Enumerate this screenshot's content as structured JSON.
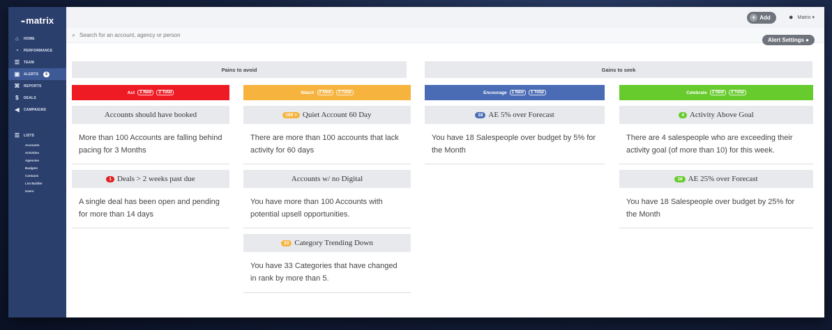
{
  "brand": {
    "name": "matrix"
  },
  "sidebar": {
    "items": [
      {
        "label": "HOME",
        "icon": "home-icon",
        "glyph": "⌂"
      },
      {
        "label": "PERFORMANCE",
        "icon": "chart-icon",
        "glyph": "◔"
      },
      {
        "label": "TEAM",
        "icon": "team-icon",
        "glyph": "☰"
      },
      {
        "label": "ALERTS",
        "icon": "alert-icon",
        "glyph": "▣",
        "badge": "6",
        "active": true
      },
      {
        "label": "REPORTS",
        "icon": "report-icon",
        "glyph": "⌘"
      },
      {
        "label": "DEALS",
        "icon": "dollar-icon",
        "glyph": "$"
      },
      {
        "label": "CAMPAIGNS",
        "icon": "megaphone-icon",
        "glyph": "◀"
      }
    ],
    "lists": {
      "label": "LISTS",
      "icon": "list-icon",
      "glyph": "☰",
      "items": [
        "Accounts",
        "Activities",
        "Agencies",
        "Budgets",
        "Contacts",
        "List Builder",
        "Users"
      ]
    }
  },
  "topbar": {
    "add_label": "Add",
    "user_label": "Matrix ▾"
  },
  "search": {
    "placeholder": "Search for an account, agency or person"
  },
  "alert_settings": {
    "label": "Alert Settings ●"
  },
  "sections": {
    "pains": "Pains to avoid",
    "gains": "Gains to seek"
  },
  "colors": {
    "act": "#ee1b24",
    "watch": "#f6b33e",
    "encourage": "#4a6cb5",
    "celebrate": "#67cb2e"
  },
  "columns": [
    {
      "name": "Act",
      "new": "1 New",
      "total": "2 Total",
      "cards": [
        {
          "title": "Accounts should have booked",
          "count": "",
          "body": "More than 100 Accounts are falling behind pacing for 3 Months"
        },
        {
          "title": "Deals > 2 weeks past due",
          "count": "1",
          "count_color": "#e02020",
          "body": "A single deal has been open and pending for more than 14 days"
        }
      ]
    },
    {
      "name": "Watch",
      "new": "2 New",
      "total": "3 Total",
      "cards": [
        {
          "title": "Quiet Account 60 Day",
          "count": "100 +",
          "count_color": "#f6b33e",
          "body": "There are more than 100 accounts that lack activity for 60 days"
        },
        {
          "title": "Accounts w/ no Digital",
          "count": "",
          "body": "You have more than 100 Accounts with potential upsell opportunities."
        },
        {
          "title": "Category Trending Down",
          "count": "33",
          "count_color": "#f6b33e",
          "body": "You have 33 Categories that have changed in rank by more than 5."
        }
      ]
    },
    {
      "name": "Encourage",
      "new": "1 New",
      "total": "1 Total",
      "cards": [
        {
          "title": "AE 5% over Forecast",
          "count": "18",
          "count_color": "#4a6cb5",
          "body": "You have 18 Salespeople over budget by 5% for the Month"
        }
      ]
    },
    {
      "name": "Celebrate",
      "new": "2 New",
      "total": "2 Total",
      "cards": [
        {
          "title": "Activity Above Goal",
          "count": "4",
          "count_color": "#67cb2e",
          "body": "There are 4 salespeople who are exceeding their activity goal (of more than 10) for this week."
        },
        {
          "title": "AE 25% over Forecast",
          "count": "18",
          "count_color": "#67cb2e",
          "body": "You have 18 Salespeople over budget by 25% for the Month"
        }
      ]
    }
  ]
}
